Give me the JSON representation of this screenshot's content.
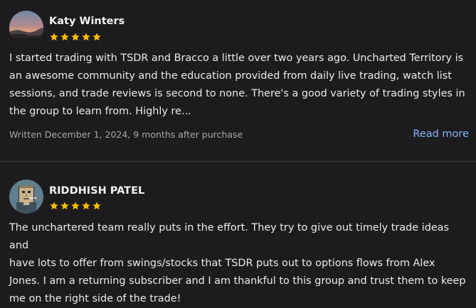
{
  "colors": {
    "background": "#1c1c1e",
    "star": "#fbbc04",
    "link": "#8ab4f8",
    "muted": "#a9a9ad",
    "divider": "#38383b"
  },
  "reviews": [
    {
      "author": "Katy Winters",
      "avatar_icon": "landscape-photo-avatar",
      "rating": 5,
      "max_rating": 5,
      "lines": [
        "I started trading with TSDR and Bracco a little over two years ago. Uncharted Territory is",
        "an awesome community and the education provided from daily live trading, watch list",
        "sessions, and trade reviews is second to none. There's a good variety of trading styles in",
        "the group to learn from. Highly re..."
      ],
      "meta": "Written December 1, 2024, 9 months after purchase",
      "read_more_label": "Read more"
    },
    {
      "author": "RIDDHISH PATEL",
      "avatar_icon": "pixel-art-avatar",
      "rating": 5,
      "max_rating": 5,
      "lines": [
        "The unchartered team really puts in the effort. They try to give out timely trade ideas and",
        "have lots to offer from swings/stocks that TSDR puts out to options flows from Alex",
        "Jones. I am a returning subscriber and I am thankful to this group and trust them to keep",
        "me on the right side of the trade!"
      ]
    }
  ]
}
